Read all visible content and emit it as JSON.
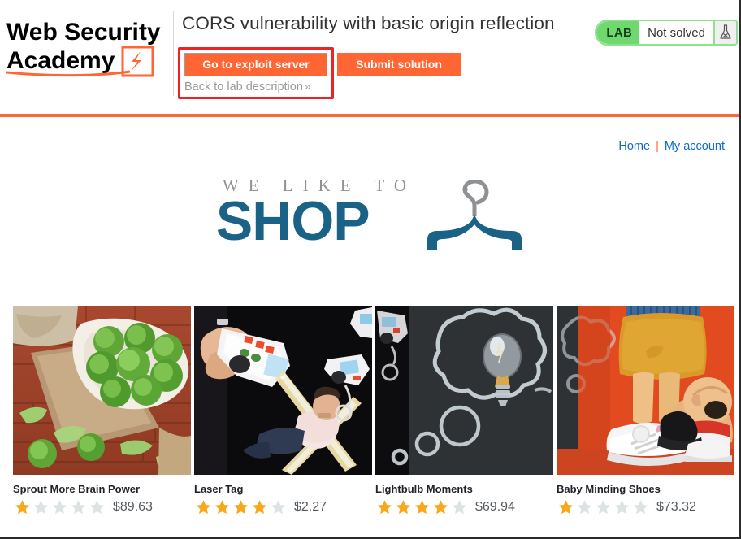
{
  "lab": {
    "brand_line1": "Web Security",
    "brand_line2": "Academy",
    "title": "CORS vulnerability with basic origin reflection",
    "exploit_button": "Go to exploit server",
    "submit_button": "Submit solution",
    "back_link": "Back to lab description",
    "back_link_chevron": "»",
    "badge": "LAB",
    "status": "Not solved",
    "flask_icon": "flask-icon",
    "accent_color": "#ff6633",
    "status_green": "#6fd96f"
  },
  "nav": {
    "home": "Home",
    "separator": "|",
    "my_account": "My account"
  },
  "shop": {
    "tagline": "WE LIKE TO",
    "wordmark": "SHOP",
    "hanger_icon": "clothes-hanger-icon"
  },
  "products": [
    {
      "name": "Sprout More Brain Power",
      "price": "$89.63",
      "rating": 1,
      "image_alt": "brussels-sprouts-in-bowl"
    },
    {
      "name": "Laser Tag",
      "price": "$2.27",
      "rating": 4,
      "image_alt": "laser-tag-guns-dark-scene"
    },
    {
      "name": "Lightbulb Moments",
      "price": "$69.94",
      "rating": 4,
      "image_alt": "lightbulb-on-chalkboard-thought-bubble"
    },
    {
      "name": "Baby Minding Shoes",
      "price": "$73.32",
      "rating": 1,
      "image_alt": "figurine-child-shoes-orange-background"
    }
  ],
  "theme": {
    "star_filled": "#f7a81b",
    "star_empty": "#dde2e4",
    "link_blue": "#0d6cc7",
    "shop_blue": "#1b6287"
  }
}
